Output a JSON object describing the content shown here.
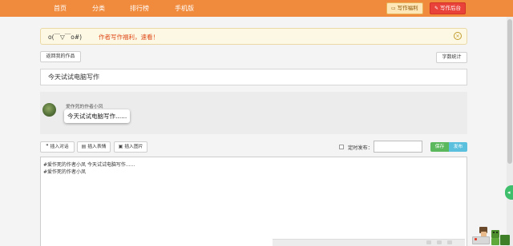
{
  "nav": {
    "items": [
      "首页",
      "分类",
      "排行榜",
      "手机版"
    ],
    "guide_button": "写作福利",
    "admin_button": "写作后台"
  },
  "notice": {
    "face": "o(￣▽￣o#)",
    "text": "作者写作福利，速看！"
  },
  "actions": {
    "back_button": "返回我的作品",
    "word_count_button": "字数统计"
  },
  "title_input": {
    "value": "今天试试电脑写作"
  },
  "preview": {
    "author": "爱作死的作者小凤",
    "message": "今天试试电脑写作......"
  },
  "toolbar": {
    "insert_dialog": "插入对话",
    "insert_emoji": "插入表情",
    "insert_image": "插入图片",
    "schedule_label": "定时发布：",
    "schedule_value": "",
    "save_button": "保存",
    "publish_button": "发布"
  },
  "editor": {
    "lines": [
      "#爱作死的作者小凤 今天试试电脑写作......",
      "#爱作死的作者小凤"
    ]
  },
  "colors": {
    "topbar": "#f08a3c",
    "notice_text": "#e04b1c",
    "save": "#5cb85c",
    "publish": "#5bc0de",
    "admin": "#e9423a"
  },
  "icons": [
    "edit-icon",
    "book-icon",
    "close-circle-icon",
    "comment-icon",
    "emoji-icon",
    "image-icon",
    "feedback-icon"
  ]
}
